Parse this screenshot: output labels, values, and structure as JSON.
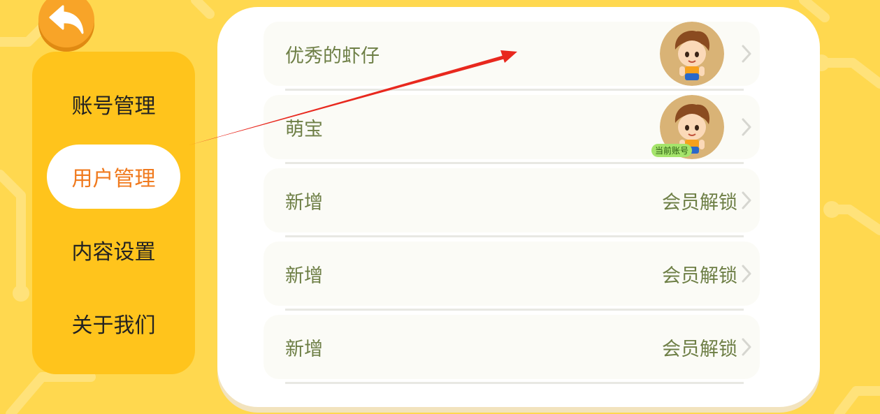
{
  "back_button": {
    "icon": "back-arrow-icon"
  },
  "sidebar": {
    "items": [
      {
        "label": "账号管理",
        "active": false
      },
      {
        "label": "用户管理",
        "active": true
      },
      {
        "label": "内容设置",
        "active": false
      },
      {
        "label": "关于我们",
        "active": false
      }
    ]
  },
  "users": [
    {
      "name": "优秀的虾仔",
      "avatar": "boy-avatar-icon",
      "badge": ""
    },
    {
      "name": "萌宝",
      "avatar": "boy-avatar-icon",
      "badge": "当前账号"
    },
    {
      "name": "新增",
      "action": "会员解锁"
    },
    {
      "name": "新增",
      "action": "会员解锁"
    },
    {
      "name": "新增",
      "action": "会员解锁"
    }
  ],
  "colors": {
    "background": "#FFD84F",
    "sidebar": "#FFC41C",
    "active_text": "#F07A1E",
    "row_text": "#6E7F46",
    "annotation_arrow": "#E8281E"
  }
}
